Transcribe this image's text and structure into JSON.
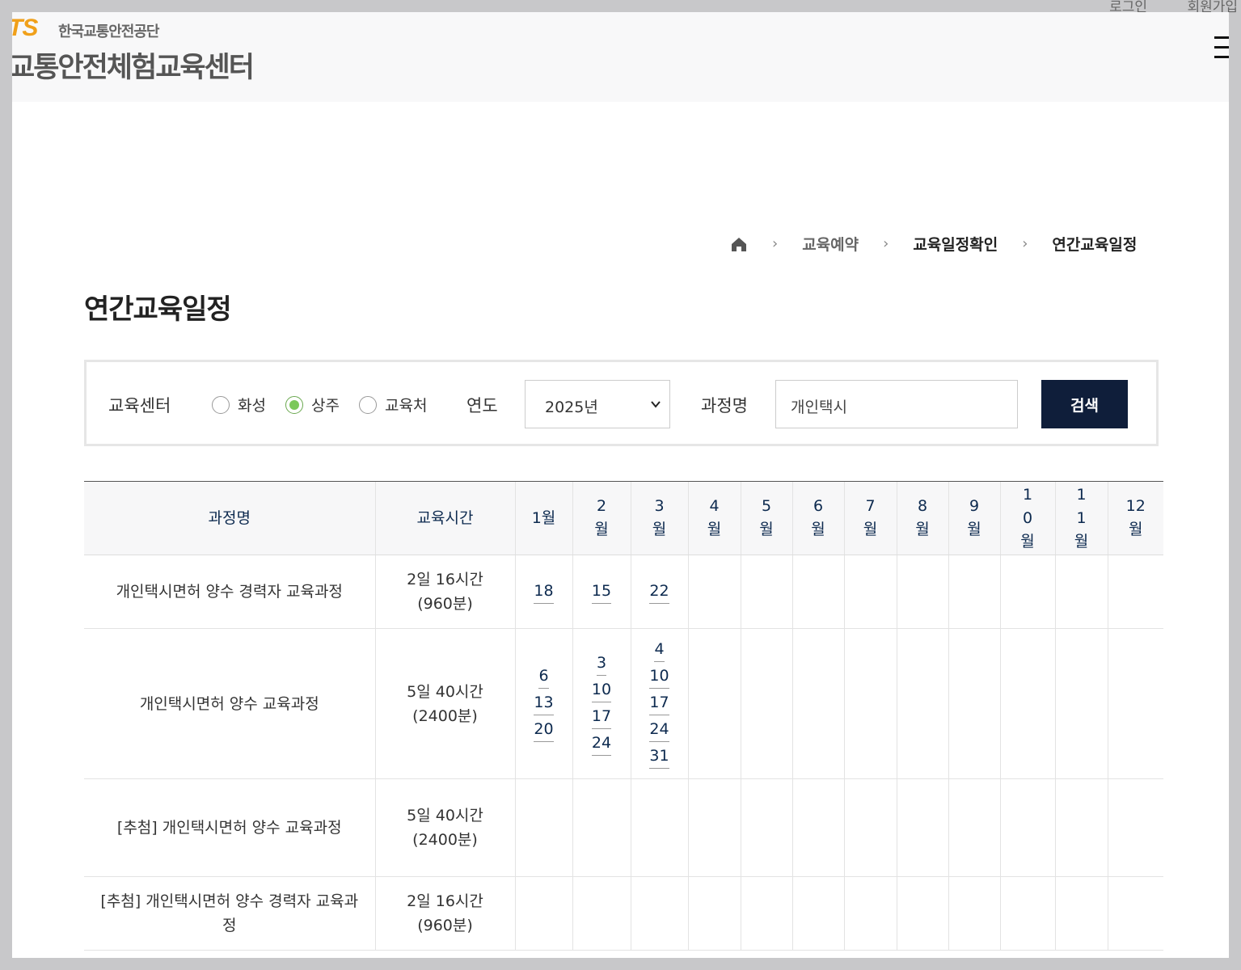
{
  "top_links": {
    "login": "로그인",
    "signup": "회원가입"
  },
  "header": {
    "logo_ts": "TS",
    "logo_org": "한국교통안전공단",
    "logo_title": "교통안전체험교육센터"
  },
  "breadcrumb": {
    "level1": "교육예약",
    "level2": "교육일정확인",
    "level3": "연간교육일정"
  },
  "page_title": "연간교육일정",
  "search": {
    "center_label": "교육센터",
    "centers": [
      "화성",
      "상주",
      "교육처"
    ],
    "selected_center": "상주",
    "year_label": "연도",
    "year_value": "2025년",
    "course_label": "과정명",
    "course_value": "개인택시",
    "button": "검색"
  },
  "table": {
    "col_course": "과정명",
    "col_time": "교육시간",
    "months": [
      "1월",
      "2월",
      "3월",
      "4월",
      "5월",
      "6월",
      "7월",
      "8월",
      "9월",
      "10월",
      "11월",
      "12월"
    ],
    "rows": [
      {
        "course": "개인택시면허 양수 경력자 교육과정",
        "time": "2일 16시간(960분)",
        "days": [
          [
            "18"
          ],
          [
            "15"
          ],
          [
            "22"
          ],
          [],
          [],
          [],
          [],
          [],
          [],
          [],
          [],
          []
        ]
      },
      {
        "course": "개인택시면허 양수 교육과정",
        "time": "5일 40시간(2400분)",
        "days": [
          [
            "6",
            "13",
            "20"
          ],
          [
            "3",
            "10",
            "17",
            "24"
          ],
          [
            "4",
            "10",
            "17",
            "24",
            "31"
          ],
          [],
          [],
          [],
          [],
          [],
          [],
          [],
          [],
          []
        ]
      },
      {
        "course": "[추첨] 개인택시면허 양수 교육과정",
        "time": "5일 40시간(2400분)",
        "days": [
          [],
          [],
          [],
          [],
          [],
          [],
          [],
          [],
          [],
          [],
          [],
          []
        ]
      },
      {
        "course": "[추첨] 개인택시면허 양수 경력자 교육과정",
        "time": "2일 16시간(960분)",
        "days": [
          [],
          [],
          [],
          [],
          [],
          [],
          [],
          [],
          [],
          [],
          [],
          []
        ]
      }
    ]
  }
}
